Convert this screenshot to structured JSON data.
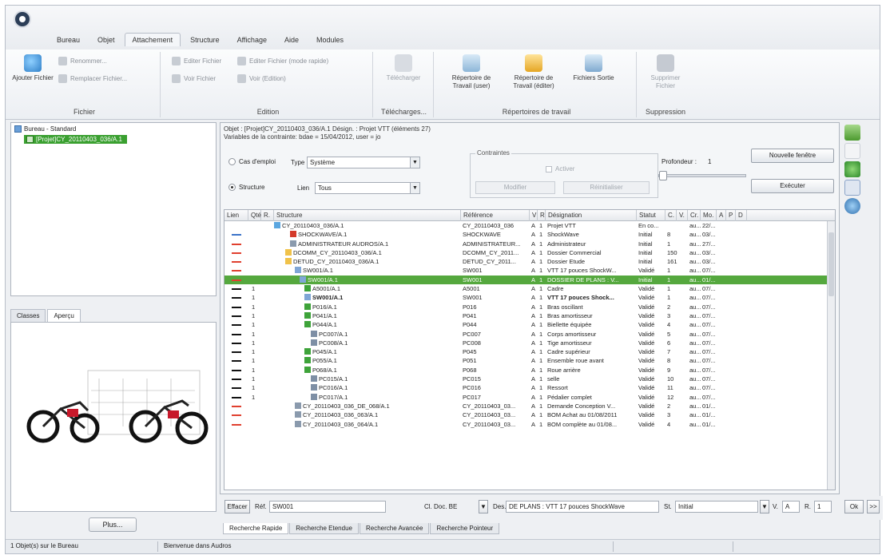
{
  "app": {
    "logo": "app-logo-icon"
  },
  "menu_tabs": [
    "Bureau",
    "Objet",
    "Attachement",
    "Structure",
    "Affichage",
    "Aide",
    "Modules"
  ],
  "ribbon": {
    "fichier": {
      "title": "Fichier",
      "add_label": "Ajouter Fichier",
      "rename_label": "Renommer...",
      "replace_label": "Remplacer Fichier..."
    },
    "edition": {
      "title": "Edition",
      "edit_file": "Editer Fichier",
      "edit_file_readonly": "Editer Fichier (mode rapide)",
      "view_file": "Voir Fichier",
      "view_edited": "Voir (Edition)"
    },
    "telechargement": {
      "title": "Télécharges...",
      "download": "Télécharger"
    },
    "repertoires": {
      "title": "Répertoires de travail",
      "user_dir": "Répertoire de Travail (user)",
      "edit_dir": "Répertoire de Travail (éditer)",
      "output_files": "Fichiers Sortie"
    },
    "suppression": {
      "title": "Suppression",
      "delete": "Supprimer Fichier"
    }
  },
  "tree": {
    "root": "Bureau - Standard",
    "selected": "[Projet]CY_20110403_036/A.1"
  },
  "left_tabs": [
    "Classes",
    "Aperçu"
  ],
  "left_tab_active": "Aperçu",
  "plus_button": "Plus...",
  "main": {
    "object_line": "Objet : [Projet]CY_20110403_036/A.1 Désign. : Projet VTT (éléments 27)",
    "variables_line": "Variables de la contrainte: bdae = 15/04/2012, user = jo",
    "cas_emploi": "Cas d'emploi",
    "type_label": "Type",
    "type_value": "Système",
    "structure_label": "Structure",
    "lien_label": "Lien",
    "lien_value": "Tous",
    "contraintes_title": "Contraintes",
    "activer_label": "Activer",
    "modifier_label": "Modifier",
    "reinitialiser_label": "Réinitialiser",
    "profondeur_label": "Profondeur :",
    "profondeur_value": "1",
    "nouvelle_fenetre": "Nouvelle fenêtre",
    "executer": "Exécuter"
  },
  "table": {
    "headers": [
      "Lien",
      "Qté",
      "R.",
      "Structure",
      "Référence",
      "V",
      "R",
      "Désignation",
      "Statut",
      "C.",
      "V.",
      "Cr.",
      "Mo.",
      "A",
      "P",
      "D"
    ],
    "rows": [
      {
        "lien": "",
        "qte": "",
        "structure": "CY_20110403_036/A.1",
        "ref": "CY_20110403_036",
        "v": "A",
        "r": "1",
        "des": "Projet VTT",
        "statut": "En co...",
        "c": "",
        "cr": "au...",
        "mo": "22/...",
        "indent": 90,
        "icon": "project"
      },
      {
        "lien": "blue",
        "qte": "",
        "structure": "SHOCKWAVE/A.1",
        "ref": "SHOCKWAVE",
        "v": "A",
        "r": "1",
        "des": "ShockWave",
        "statut": "Initial",
        "c": "8",
        "cr": "au...",
        "mo": "03/...",
        "indent": 110,
        "icon": "red"
      },
      {
        "lien": "red",
        "qte": "",
        "structure": "ADMINISTRATEUR AUDROS/A.1",
        "ref": "ADMINISTRATEUR...",
        "v": "A",
        "r": "1",
        "des": "Administrateur",
        "statut": "Initial",
        "c": "1",
        "cr": "au...",
        "mo": "27/...",
        "indent": 110,
        "icon": "grey"
      },
      {
        "lien": "red",
        "qte": "",
        "structure": "DCOMM_CY_20110403_036/A.1",
        "ref": "DCOMM_CY_2011...",
        "v": "A",
        "r": "1",
        "des": "Dossier Commercial",
        "statut": "Initial",
        "c": "150",
        "cr": "au...",
        "mo": "03/...",
        "indent": 104,
        "icon": "folder"
      },
      {
        "lien": "red",
        "qte": "",
        "structure": "DETUD_CY_20110403_036/A.1",
        "ref": "DETUD_CY_2011...",
        "v": "A",
        "r": "1",
        "des": "Dossier Etude",
        "statut": "Initial",
        "c": "161",
        "cr": "au...",
        "mo": "03/...",
        "indent": 104,
        "icon": "folder"
      },
      {
        "lien": "red",
        "qte": "",
        "structure": "SW001/A.1",
        "ref": "SW001",
        "v": "A",
        "r": "1",
        "des": "VTT 17 pouces ShockW...",
        "statut": "Validé",
        "c": "1",
        "cr": "au...",
        "mo": "07/...",
        "indent": 116,
        "icon": "doc"
      },
      {
        "lien": "red",
        "qte": "",
        "structure": "SW001/A.1",
        "ref": "SW001",
        "v": "A",
        "r": "1",
        "des": "DOSSIER DE PLANS : V...",
        "statut": "Initial",
        "c": "1",
        "cr": "au...",
        "mo": "01/...",
        "indent": 122,
        "icon": "doc",
        "selected": true
      },
      {
        "lien": "black",
        "qte": "1",
        "structure": "A5001/A.1",
        "ref": "A5001",
        "v": "A",
        "r": "1",
        "des": "Cadre",
        "statut": "Validé",
        "c": "1",
        "cr": "au...",
        "mo": "07/...",
        "indent": 128,
        "icon": "green"
      },
      {
        "lien": "black",
        "qte": "1",
        "structure": "SW001/A.1",
        "ref": "SW001",
        "v": "A",
        "r": "1",
        "des": "VTT 17 pouces Shock...",
        "statut": "Validé",
        "c": "1",
        "cr": "au...",
        "mo": "07/...",
        "indent": 128,
        "icon": "doc",
        "bold": true
      },
      {
        "lien": "black",
        "qte": "1",
        "structure": "P016/A.1",
        "ref": "P016",
        "v": "A",
        "r": "1",
        "des": "Bras oscillant",
        "statut": "Validé",
        "c": "2",
        "cr": "au...",
        "mo": "07/...",
        "indent": 128,
        "icon": "green"
      },
      {
        "lien": "black",
        "qte": "1",
        "structure": "P041/A.1",
        "ref": "P041",
        "v": "A",
        "r": "1",
        "des": "Bras amortisseur",
        "statut": "Validé",
        "c": "3",
        "cr": "au...",
        "mo": "07/...",
        "indent": 128,
        "icon": "green"
      },
      {
        "lien": "black",
        "qte": "1",
        "structure": "P044/A.1",
        "ref": "P044",
        "v": "A",
        "r": "1",
        "des": "Biellette équipée",
        "statut": "Validé",
        "c": "4",
        "cr": "au...",
        "mo": "07/...",
        "indent": 128,
        "icon": "green"
      },
      {
        "lien": "black",
        "qte": "1",
        "structure": "PC007/A.1",
        "ref": "PC007",
        "v": "A",
        "r": "1",
        "des": "Corps amortisseur",
        "statut": "Validé",
        "c": "5",
        "cr": "au...",
        "mo": "07/...",
        "indent": 136,
        "icon": "part"
      },
      {
        "lien": "black",
        "qte": "1",
        "structure": "PC008/A.1",
        "ref": "PC008",
        "v": "A",
        "r": "1",
        "des": "Tige amortisseur",
        "statut": "Validé",
        "c": "6",
        "cr": "au...",
        "mo": "07/...",
        "indent": 136,
        "icon": "part"
      },
      {
        "lien": "black",
        "qte": "1",
        "structure": "P045/A.1",
        "ref": "P045",
        "v": "A",
        "r": "1",
        "des": "Cadre supérieur",
        "statut": "Validé",
        "c": "7",
        "cr": "au...",
        "mo": "07/...",
        "indent": 128,
        "icon": "green"
      },
      {
        "lien": "black",
        "qte": "1",
        "structure": "P055/A.1",
        "ref": "P051",
        "v": "A",
        "r": "1",
        "des": "Ensemble roue avant",
        "statut": "Validé",
        "c": "8",
        "cr": "au...",
        "mo": "07/...",
        "indent": 128,
        "icon": "green"
      },
      {
        "lien": "black",
        "qte": "1",
        "structure": "P068/A.1",
        "ref": "P068",
        "v": "A",
        "r": "1",
        "des": "Roue arrière",
        "statut": "Validé",
        "c": "9",
        "cr": "au...",
        "mo": "07/...",
        "indent": 128,
        "icon": "green"
      },
      {
        "lien": "black",
        "qte": "1",
        "structure": "PC015/A.1",
        "ref": "PC015",
        "v": "A",
        "r": "1",
        "des": "selle",
        "statut": "Validé",
        "c": "10",
        "cr": "au...",
        "mo": "07/...",
        "indent": 136,
        "icon": "part"
      },
      {
        "lien": "black",
        "qte": "1",
        "structure": "PC016/A.1",
        "ref": "PC016",
        "v": "A",
        "r": "1",
        "des": "Ressort",
        "statut": "Validé",
        "c": "11",
        "cr": "au...",
        "mo": "07/...",
        "indent": 136,
        "icon": "part"
      },
      {
        "lien": "black",
        "qte": "1",
        "structure": "PC017/A.1",
        "ref": "PC017",
        "v": "A",
        "r": "1",
        "des": "Pédalier complet",
        "statut": "Validé",
        "c": "12",
        "cr": "au...",
        "mo": "07/...",
        "indent": 136,
        "icon": "part"
      },
      {
        "lien": "red",
        "qte": "",
        "structure": "CY_20110403_036_DE_068/A.1",
        "ref": "CY_20110403_03...",
        "v": "A",
        "r": "1",
        "des": "Demande Conception V...",
        "statut": "Validé",
        "c": "2",
        "cr": "au...",
        "mo": "01/...",
        "indent": 116,
        "icon": "grey"
      },
      {
        "lien": "red",
        "qte": "",
        "structure": "CY_20110403_036_063/A.1",
        "ref": "CY_20110403_03...",
        "v": "A",
        "r": "1",
        "des": "BOM Achat au 01/08/2011",
        "statut": "Validé",
        "c": "3",
        "cr": "au...",
        "mo": "01/...",
        "indent": 116,
        "icon": "grey"
      },
      {
        "lien": "red",
        "qte": "",
        "structure": "CY_20110403_036_064/A.1",
        "ref": "CY_20110403_03...",
        "v": "A",
        "r": "1",
        "des": "BOM complète au 01/08...",
        "statut": "Validé",
        "c": "4",
        "cr": "au...",
        "mo": "01/...",
        "indent": 116,
        "icon": "grey"
      }
    ]
  },
  "search": {
    "effacer": "Effacer",
    "ref_label": "Réf.",
    "ref_value": "SW001",
    "cl_label": "Cl. Doc. BE",
    "des_label": "Des.",
    "des_value": "DE PLANS : VTT 17 pouces ShockWave",
    "st_label": "St.",
    "st_value": "Initial",
    "v_label": "V.",
    "v_value": "A",
    "r_label": "R.",
    "r_value": "1",
    "ok_label": "Ok",
    "more_label": ">>"
  },
  "search_tabs": [
    "Recherche Rapide",
    "Recherche Etendue",
    "Recherche Avancée",
    "Recherche Pointeur"
  ],
  "status": {
    "left": "1 Objet(s) sur le Bureau",
    "message": "Bienvenue dans Audros"
  },
  "colors": {
    "selection": "#55a83e",
    "tree_selection": "#3aa030"
  }
}
